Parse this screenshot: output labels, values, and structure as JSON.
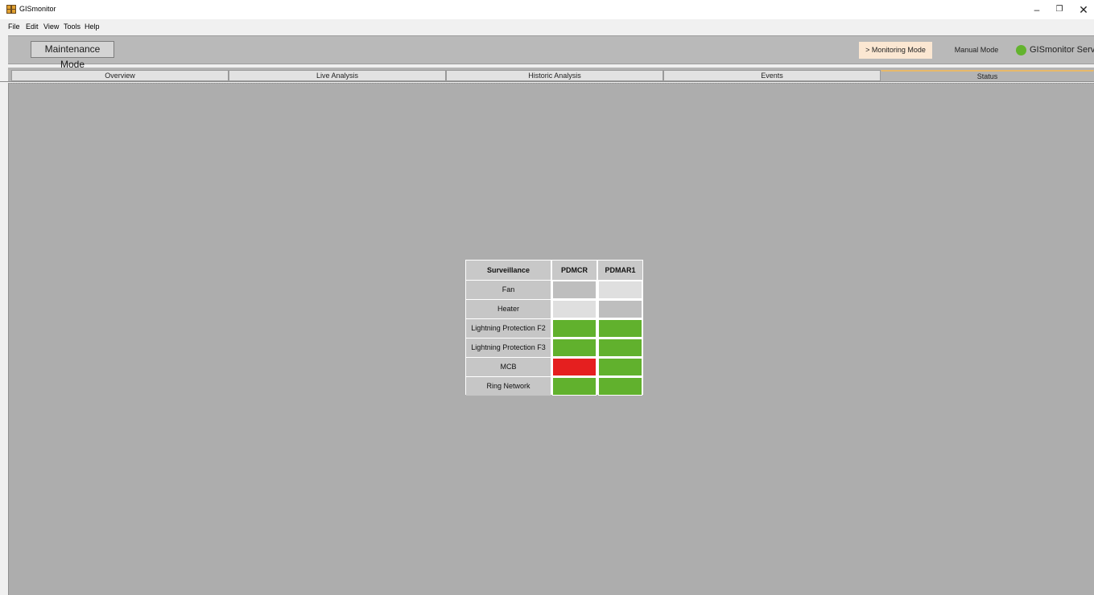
{
  "window": {
    "title": "GISmonitor",
    "controls": {
      "minimize": "–",
      "maximize": "❐",
      "close": "✕"
    }
  },
  "menu": [
    "File",
    "Edit",
    "View",
    "Tools",
    "Help"
  ],
  "toolbar": {
    "maintenance_button": "Maintenance Mode",
    "monitoring_mode": "> Monitoring Mode",
    "manual_mode": "Manual Mode",
    "server_label": "GISmonitor Serve",
    "server_status_color": "#63b32e"
  },
  "tabs": [
    {
      "label": "Overview",
      "active": false
    },
    {
      "label": "Live Analysis",
      "active": false
    },
    {
      "label": "Historic Analysis",
      "active": false
    },
    {
      "label": "Events",
      "active": false
    },
    {
      "label": "Status",
      "active": true
    }
  ],
  "status_table": {
    "headers": [
      "Surveillance",
      "PDMCR",
      "PDMAR1"
    ],
    "rows": [
      {
        "label": "Fan",
        "states": [
          "inactive",
          "off"
        ]
      },
      {
        "label": "Heater",
        "states": [
          "off",
          "inactive"
        ]
      },
      {
        "label": "Lightning Protection F2",
        "states": [
          "ok",
          "ok"
        ]
      },
      {
        "label": "Lightning Protection F3",
        "states": [
          "ok",
          "ok"
        ]
      },
      {
        "label": "MCB",
        "states": [
          "alarm",
          "ok"
        ]
      },
      {
        "label": "Ring Network",
        "states": [
          "ok",
          "ok"
        ]
      }
    ],
    "state_colors": {
      "ok": "#61b12d",
      "alarm": "#e51f1f",
      "off": "#dfdfdf",
      "inactive": "#bebebe"
    }
  }
}
